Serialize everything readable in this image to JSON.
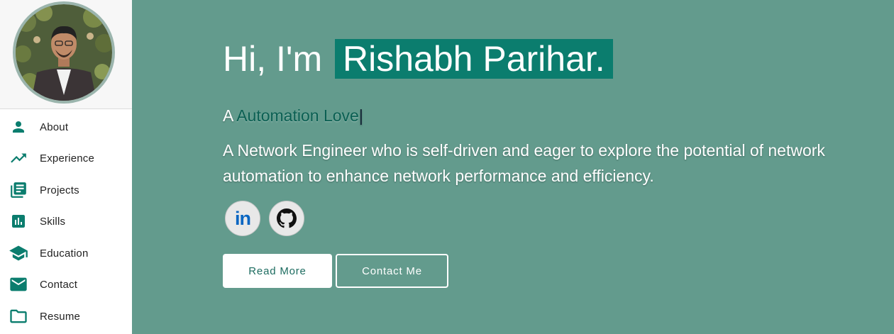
{
  "sidebar": {
    "items": [
      {
        "label": "About",
        "icon": "person-icon"
      },
      {
        "label": "Experience",
        "icon": "trending-up-icon"
      },
      {
        "label": "Projects",
        "icon": "library-books-icon"
      },
      {
        "label": "Skills",
        "icon": "bar-chart-icon"
      },
      {
        "label": "Education",
        "icon": "graduation-cap-icon"
      },
      {
        "label": "Contact",
        "icon": "envelope-icon"
      },
      {
        "label": "Resume",
        "icon": "folder-icon"
      }
    ]
  },
  "hero": {
    "greeting": "Hi, I'm",
    "name": "Rishabh Parihar.",
    "typed_prefix": "A",
    "typed_text": "Automation Love",
    "typed_caret": "|",
    "description": "A Network Engineer who is self-driven and eager to explore the potential of network automation to enhance network performance and efficiency."
  },
  "social": {
    "linkedin_text": "in",
    "linkedin_icon": "linkedin-icon",
    "github_icon": "github-icon"
  },
  "buttons": {
    "read_more": "Read More",
    "contact_me": "Contact Me"
  },
  "colors": {
    "background": "#639b8d",
    "accent": "#0b7d6e",
    "icon": "#0b7d6e",
    "linkedin": "#0a66c2"
  }
}
